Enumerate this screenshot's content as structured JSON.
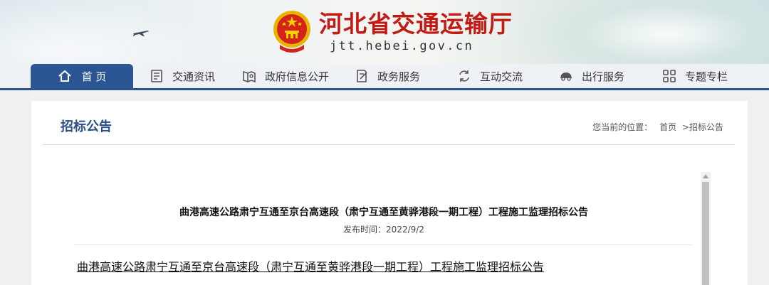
{
  "header": {
    "site_title": "河北省交通运输厅",
    "site_url": "jtt.hebei.gov.cn"
  },
  "nav": {
    "items": [
      {
        "label": "首 页",
        "icon": "home-icon"
      },
      {
        "label": "交通资讯",
        "icon": "news-icon"
      },
      {
        "label": "政府信息公开",
        "icon": "government-info-icon"
      },
      {
        "label": "政务服务",
        "icon": "service-icon"
      },
      {
        "label": "互动交流",
        "icon": "interaction-icon"
      },
      {
        "label": "出行服务",
        "icon": "car-icon"
      },
      {
        "label": "专题专栏",
        "icon": "grid-icon"
      }
    ]
  },
  "page": {
    "title": "招标公告",
    "breadcrumb_prefix": "您当前的位置：",
    "breadcrumb_home": "首页",
    "breadcrumb_sep": ">",
    "breadcrumb_current": "招标公告"
  },
  "article": {
    "title": "曲港高速公路肃宁互通至京台高速段（肃宁互通至黄骅港段一期工程）工程施工监理招标公告",
    "date": "发布时间：2022/9/2",
    "attachment_link": "曲港高速公路肃宁互通至京台高速段（肃宁互通至黄骅港段一期工程）工程施工监理招标公告"
  },
  "colors": {
    "brand_red": "#c41a14",
    "nav_blue": "#2c5693",
    "title_blue": "#2b4f8a"
  }
}
